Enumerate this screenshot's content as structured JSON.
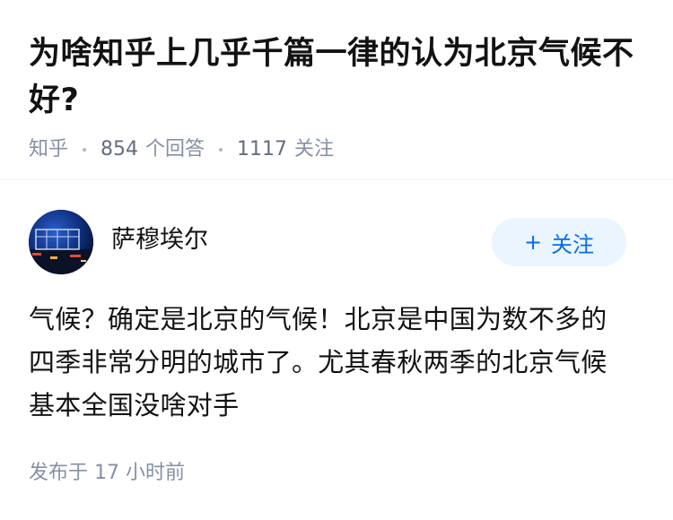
{
  "question": {
    "title": "为啥知乎上几乎千篇一律的认为北京气候不好?",
    "source": "知乎",
    "answer_count": "854",
    "answer_label": "个回答",
    "follower_count": "1117",
    "follower_label": "关注"
  },
  "answer": {
    "author_name": "萨穆埃尔",
    "follow_plus": "+",
    "follow_label": "关注",
    "content": "气候？确定是北京的气候！北京是中国为数不多的四季非常分明的城市了。尤其春秋两季的北京气候基本全国没啥对手",
    "published": "发布于 17 小时前"
  },
  "colors": {
    "accent": "#056de8",
    "follow_bg": "#ebf5ff",
    "meta_text": "#8590a6"
  }
}
